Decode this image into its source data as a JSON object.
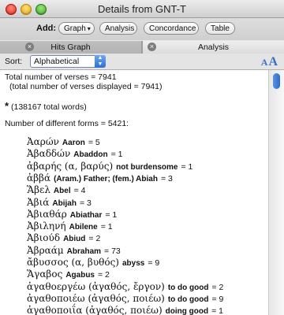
{
  "window": {
    "title": "Details from GNT-T"
  },
  "toolbar": {
    "add_label": "Add:",
    "graph_button": "Graph",
    "analysis_button": "Analysis",
    "concordance_button": "Concordance",
    "table_button": "Table"
  },
  "tabs": [
    {
      "label": "Hits Graph",
      "close": "×"
    },
    {
      "label": "Analysis",
      "close": "×"
    }
  ],
  "sort": {
    "label": "Sort:",
    "selected": "Alphabetical"
  },
  "summary": {
    "total_verses": "Total number of verses = 7941",
    "displayed_verses": "(total number of verses displayed = 7941)",
    "star": "*",
    "total_words": "(138167 total words)",
    "forms": "Number of different forms = 5421:"
  },
  "entries": [
    {
      "greek": "Ἀαρών",
      "gloss": "Aaron",
      "count": "= 5"
    },
    {
      "greek": "Ἀβαδδών",
      "gloss": "Abaddon",
      "count": "= 1"
    },
    {
      "greek": "ἀβαρής (α, βαρύς)",
      "gloss": "not burdensome",
      "count": "= 1"
    },
    {
      "greek": "ἀββά",
      "gloss": "(Aram.) Father; (fem.) Abiah",
      "count": "= 3"
    },
    {
      "greek": "Ἅβελ",
      "gloss": "Abel",
      "count": "= 4"
    },
    {
      "greek": "Ἀβιά",
      "gloss": "Abijah",
      "count": "= 3"
    },
    {
      "greek": "Ἀβιαθάρ",
      "gloss": "Abiathar",
      "count": "= 1"
    },
    {
      "greek": "Ἀβιληνή",
      "gloss": "Abilene",
      "count": "= 1"
    },
    {
      "greek": "Ἀβιούδ",
      "gloss": "Abiud",
      "count": "= 2"
    },
    {
      "greek": "Ἀβραάμ",
      "gloss": "Abraham",
      "count": "= 73"
    },
    {
      "greek": "ἄβυσσος (α, βυθός)",
      "gloss": "abyss",
      "count": "= 9"
    },
    {
      "greek": "Ἅγαβος",
      "gloss": "Agabus",
      "count": "= 2"
    },
    {
      "greek": "ἀγαθοεργέω (ἀγαθός, ἔργον)",
      "gloss": "to do good",
      "count": "= 2"
    },
    {
      "greek": "ἀγαθοποιέω (ἀγαθός, ποιέω)",
      "gloss": "to do good",
      "count": "= 9"
    },
    {
      "greek": "ἀγαθοποιΐα (ἀγαθός, ποιέω)",
      "gloss": "doing good",
      "count": "= 1"
    },
    {
      "greek": "ἀγαθοποιός (ἀγαθός, ποιέω)",
      "gloss": "doing good",
      "count": "= 1"
    }
  ]
}
